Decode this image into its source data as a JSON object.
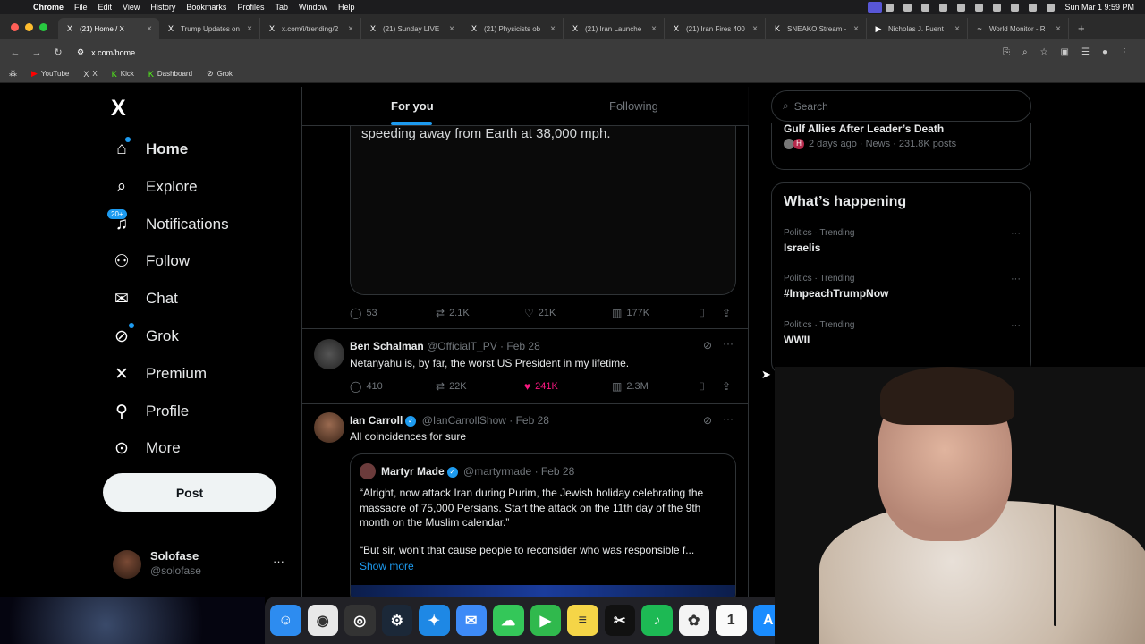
{
  "menubar": {
    "app": "Chrome",
    "items": [
      "File",
      "Edit",
      "View",
      "History",
      "Bookmarks",
      "Profiles",
      "Tab",
      "Window",
      "Help"
    ],
    "clock": "Sun Mar 1  9:59 PM"
  },
  "tabs": [
    {
      "icon": "X",
      "title": "(21) Home / X",
      "active": true
    },
    {
      "icon": "X",
      "title": "Trump Updates on"
    },
    {
      "icon": "X",
      "title": "x.com/i/trending/2"
    },
    {
      "icon": "X",
      "title": "(21) Sunday LIVE"
    },
    {
      "icon": "X",
      "title": "(21) Physicists ob"
    },
    {
      "icon": "X",
      "title": "(21) Iran Launche"
    },
    {
      "icon": "X",
      "title": "(21) Iran Fires 400"
    },
    {
      "icon": "K",
      "title": "SNEAKO Stream -"
    },
    {
      "icon": "▶",
      "title": "Nicholas J. Fuent"
    },
    {
      "icon": "~",
      "title": "World Monitor - R"
    }
  ],
  "address": {
    "url": "x.com/home"
  },
  "bookmarks": [
    {
      "icon": "▶",
      "label": "YouTube"
    },
    {
      "icon": "X",
      "label": "X"
    },
    {
      "icon": "K",
      "label": "Kick"
    },
    {
      "icon": "K",
      "label": "Dashboard"
    },
    {
      "icon": "⊘",
      "label": "Grok"
    }
  ],
  "nav": {
    "logo": "X",
    "items": [
      {
        "label": "Home",
        "icon": "home-icon",
        "glyph": "⌂"
      },
      {
        "label": "Explore",
        "icon": "search-icon",
        "glyph": "⌕"
      },
      {
        "label": "Notifications",
        "icon": "bell-icon",
        "glyph": "♫"
      },
      {
        "label": "Follow",
        "icon": "follow-icon",
        "glyph": "⚇"
      },
      {
        "label": "Chat",
        "icon": "mail-icon",
        "glyph": "✉"
      },
      {
        "label": "Grok",
        "icon": "grok-icon",
        "glyph": "⊘"
      },
      {
        "label": "Premium",
        "icon": "x-icon",
        "glyph": "✕"
      },
      {
        "label": "Profile",
        "icon": "person-icon",
        "glyph": "⚲"
      },
      {
        "label": "More",
        "icon": "more-icon",
        "glyph": "⊙"
      }
    ],
    "notif_badge": "20+",
    "post_button": "Post",
    "user": {
      "name": "Solofase",
      "handle": "@solofase"
    }
  },
  "feed": {
    "tabs": [
      "For you",
      "Following"
    ],
    "top_post": {
      "text": "speeding away from Earth at 38,000 mph.",
      "replies": "53",
      "reposts": "2.1K",
      "likes": "21K",
      "views": "177K"
    },
    "posts": [
      {
        "name": "Ben Schalman",
        "handle": "@OfficialT_PV",
        "date": "· Feb 28",
        "text": "Netanyahu is, by far, the worst US President in my lifetime.",
        "replies": "410",
        "reposts": "22K",
        "likes": "241K",
        "views": "2.3M"
      },
      {
        "name": "Ian Carroll",
        "handle": "@IanCarrollShow",
        "date": "· Feb 28",
        "text": "All coincidences for sure",
        "quote": {
          "name": "Martyr Made",
          "handle": "@martyrmade",
          "date": "· Feb 28",
          "text": "“Alright, now attack Iran during Purim, the Jewish holiday celebrating the massacre of 75,000 Persians. Start the attack on the 11th day of the 9th month on the Muslim calendar.”",
          "text2": "“But sir, won’t that cause people to reconsider who was responsible f...",
          "show_more": "Show more"
        }
      }
    ]
  },
  "sidebar": {
    "search_placeholder": "Search",
    "top_trend": {
      "title": "Gulf Allies After Leader’s Death",
      "meta": "2 days ago · News · 231.8K posts"
    },
    "happening_title": "What’s happening",
    "trends": [
      {
        "context": "Politics · Trending",
        "name": "Israelis"
      },
      {
        "context": "Politics · Trending",
        "name": "#ImpeachTrumpNow"
      },
      {
        "context": "Politics · Trending",
        "name": "WWII"
      }
    ]
  },
  "dock": [
    {
      "name": "Finder",
      "color": "#2d8cf0",
      "glyph": "☺"
    },
    {
      "name": "Chrome",
      "color": "#e8e8e8",
      "glyph": "◉"
    },
    {
      "name": "OBS",
      "color": "#333",
      "glyph": "◎"
    },
    {
      "name": "Steam",
      "color": "#1b2838",
      "glyph": "⚙"
    },
    {
      "name": "Safari",
      "color": "#1e88e5",
      "glyph": "✦"
    },
    {
      "name": "Mail",
      "color": "#3d8af7",
      "glyph": "✉"
    },
    {
      "name": "Messages",
      "color": "#34c759",
      "glyph": "☁"
    },
    {
      "name": "FaceTime",
      "color": "#30b94d",
      "glyph": "▶"
    },
    {
      "name": "Notes",
      "color": "#f5d547",
      "glyph": "≡"
    },
    {
      "name": "CapCut",
      "color": "#111",
      "glyph": "✂"
    },
    {
      "name": "Spotify",
      "color": "#1db954",
      "glyph": "♪"
    },
    {
      "name": "Photos",
      "color": "#f4f4f4",
      "glyph": "✿"
    },
    {
      "name": "Calendar",
      "color": "#fafafa",
      "glyph": "1"
    },
    {
      "name": "App Store",
      "color": "#1a8cff",
      "glyph": "A"
    }
  ]
}
